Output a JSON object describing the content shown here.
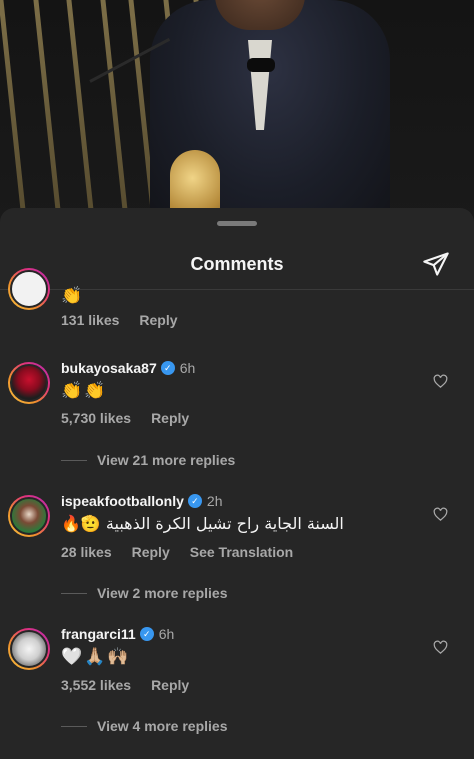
{
  "sheet": {
    "title": "Comments"
  },
  "comments": [
    {
      "username": "",
      "time": "",
      "text": "👏",
      "likes": "131 likes",
      "reply": "Reply",
      "translate": ""
    },
    {
      "username": "bukayosaka87",
      "time": "6h",
      "verified": true,
      "text": "👏👏",
      "likes": "5,730 likes",
      "reply": "Reply",
      "view_replies": "View 21 more replies"
    },
    {
      "username": "ispeakfootballonly",
      "time": "2h",
      "verified": true,
      "text": "السنة الجاية راح تشيل الكرة الذهبية 🫡🔥",
      "likes": "28 likes",
      "reply": "Reply",
      "translate": "See Translation",
      "view_replies": "View 2 more replies"
    },
    {
      "username": "frangarci11",
      "time": "6h",
      "verified": true,
      "text": "🤍🙏🏼🙌🏼",
      "likes": "3,552 likes",
      "reply": "Reply",
      "view_replies": "View 4 more replies"
    }
  ],
  "icons": {
    "share": "paper-plane-icon",
    "like": "heart-outline-icon"
  },
  "colors": {
    "sheet_bg": "#262626",
    "text_primary": "#f5f5f5",
    "text_secondary": "#a8a8a8",
    "verified": "#3897f0"
  }
}
